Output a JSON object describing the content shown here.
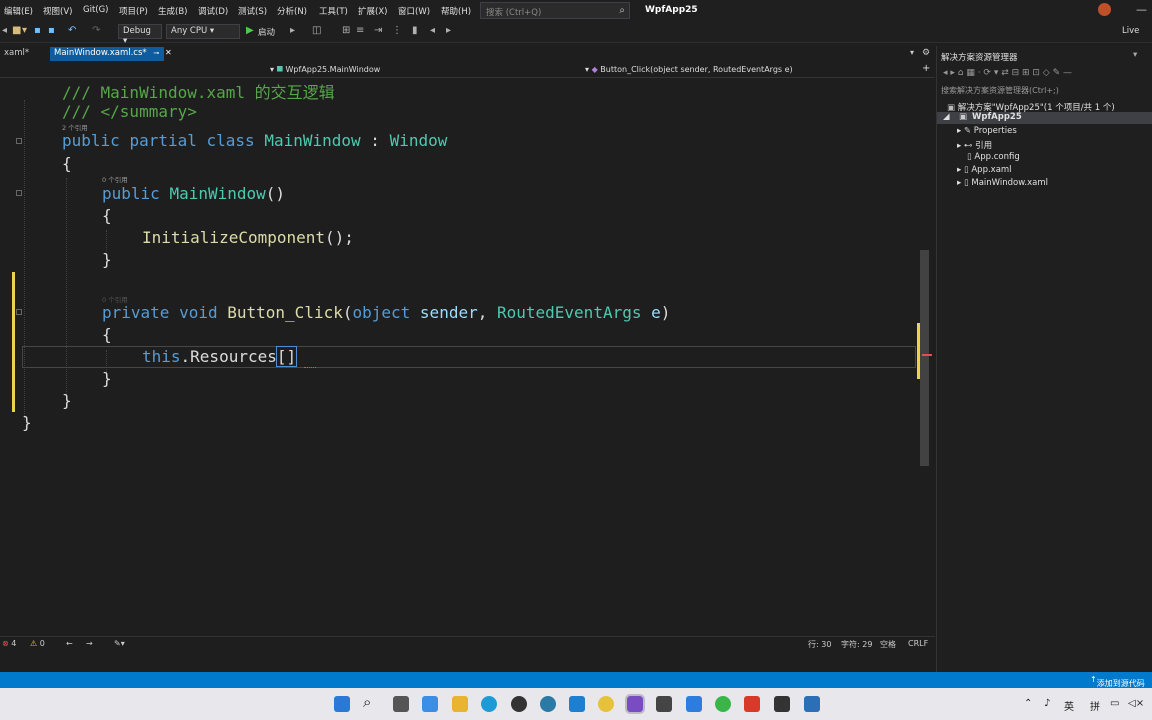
{
  "menu": {
    "items": [
      "编辑(E)",
      "视图(V)",
      "Git(G)",
      "项目(P)",
      "生成(B)",
      "调试(D)",
      "测试(S)",
      "分析(N)",
      "工具(T)",
      "扩展(X)",
      "窗口(W)",
      "帮助(H)"
    ],
    "search_placeholder": "搜索 (Ctrl+Q)",
    "app_title": "WpfApp25"
  },
  "toolbar": {
    "config": "Debug",
    "platform": "Any CPU",
    "start_label": "启动",
    "live_share": "Live"
  },
  "tabs": [
    {
      "label": "xaml*"
    },
    {
      "label": "MainWindow.xaml.cs*"
    }
  ],
  "navbar": {
    "class_path": "WpfApp25.MainWindow",
    "member": "Button_Click(object sender, RoutedEventArgs e)"
  },
  "code": {
    "line1": "/// MainWindow.xaml 的交互逻辑",
    "line2": "/// </summary>",
    "lens1": "2 个引用",
    "class_kw1": "public",
    "class_kw2": "partial",
    "class_kw3": "class",
    "class_name": "MainWindow",
    "class_colon": " : ",
    "class_base": "Window",
    "brace_open": "{",
    "brace_close": "}",
    "lens2": "0 个引用",
    "ctor_kw": "public",
    "ctor_name": "MainWindow",
    "ctor_parens": "()",
    "init_call": "InitializeComponent",
    "init_tail": "();",
    "lens3": "0 个引用",
    "method_kw1": "private",
    "method_kw2": "void",
    "method_name": "Button_Click",
    "param_open": "(",
    "param_kw": "object",
    "param_name1": "sender",
    "param_comma": ", ",
    "param_type": "RoutedEventArgs",
    "param_name2": "e",
    "param_close": ")",
    "this_kw": "this",
    "resources": ".Resources",
    "brackets": "[]"
  },
  "editor_status": {
    "errors": "4",
    "warnings": "0",
    "line": "行: 30",
    "col": "字符: 29",
    "indent": "空格",
    "eol": "CRLF"
  },
  "solution": {
    "title": "解决方案资源管理器",
    "search": "搜索解决方案资源管理器(Ctrl+;)",
    "root": "解决方案\"WpfApp25\"(1 个项目/共 1 个)",
    "project": "WpfApp25",
    "items": [
      "Properties",
      "引用",
      "App.config",
      "App.xaml",
      "MainWindow.xaml"
    ]
  },
  "statusbar": {
    "source_control": "添加到源代码"
  },
  "taskbar": {
    "ime": "英",
    "ime2": "拼"
  },
  "colors": {
    "accent": "#007acc",
    "keyword": "#569cd6",
    "type": "#4ec9b0",
    "method": "#dcdcaa",
    "comment": "#57a64a"
  }
}
